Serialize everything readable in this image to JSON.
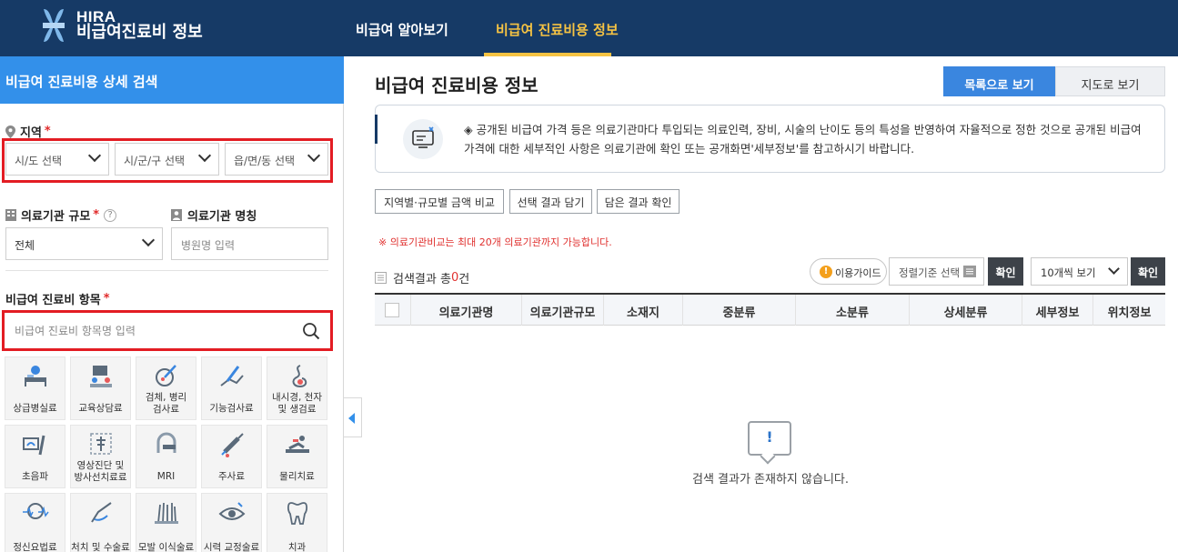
{
  "header": {
    "logo_en": "HIRA",
    "logo_ko": "비급여진료비 정보",
    "nav": [
      {
        "label": "비급여 알아보기",
        "active": false
      },
      {
        "label": "비급여 진료비용 정보",
        "active": true
      }
    ]
  },
  "sidebar": {
    "title": "비급여 진료비용 상세 검색",
    "region": {
      "label": "지역",
      "required": "*",
      "sido": "시/도 선택",
      "sigungu": "시/군/구 선택",
      "eupmyeondong": "읍/면/동 선택"
    },
    "scale": {
      "label": "의료기관 규모",
      "required": "*",
      "help": "?",
      "value": "전체"
    },
    "institution": {
      "label": "의료기관 명칭",
      "placeholder": "병원명 입력"
    },
    "items": {
      "label": "비급여 진료비 항목",
      "required": "*",
      "placeholder": "비급여 진료비 항목명 입력"
    },
    "categories": [
      {
        "label": "상급병실료",
        "icon": "hospital-bed-icon"
      },
      {
        "label": "교육상담료",
        "icon": "consultation-icon"
      },
      {
        "label": "검체, 병리\n검사료",
        "icon": "pathology-icon"
      },
      {
        "label": "기능검사료",
        "icon": "function-test-icon"
      },
      {
        "label": "내시경, 천자\n및 생검료",
        "icon": "endoscope-icon"
      },
      {
        "label": "초음파",
        "icon": "ultrasound-icon"
      },
      {
        "label": "영상진단 및\n방사선치료료",
        "icon": "radiology-icon"
      },
      {
        "label": "MRI",
        "icon": "mri-icon"
      },
      {
        "label": "주사료",
        "icon": "injection-icon"
      },
      {
        "label": "물리치료",
        "icon": "physical-therapy-icon"
      },
      {
        "label": "정신요법료",
        "icon": "psychotherapy-icon"
      },
      {
        "label": "처치 및 수술료",
        "icon": "surgery-icon"
      },
      {
        "label": "모발 이식술료",
        "icon": "hair-transplant-icon"
      },
      {
        "label": "시력 교정술료",
        "icon": "eye-icon"
      },
      {
        "label": "치과",
        "icon": "tooth-icon"
      }
    ]
  },
  "main": {
    "title": "비급여 진료비용 정보",
    "view_list": "목록으로 보기",
    "view_map": "지도로 보기",
    "notice": "◈ 공개된 비급여 가격 등은 의료기관마다 투입되는 의료인력, 장비, 시술의 난이도 등의 특성을 반영하여 자율적으로 정한 것으로 공개된 비급여 가격에 대한 세부적인 사항은 의료기관에 확인 또는 공개화면'세부정보'를 참고하시기 바랍니다.",
    "actions": [
      "지역별·규모별 금액 비교",
      "선택 결과 담기",
      "담은 결과 확인"
    ],
    "warning": "※ 의료기관비교는 최대 20개 의료기관까지 가능합니다.",
    "result_prefix": "검색결과 총",
    "result_count": "0",
    "result_suffix": "건",
    "guide": "이용가이드",
    "guide_badge": "!",
    "sort": "정렬기준 선택",
    "confirm": "확인",
    "page_size": "10개씩 보기",
    "confirm2": "확인",
    "columns": [
      "의료기관명",
      "의료기관규모",
      "소재지",
      "중분류",
      "소분류",
      "상세분류",
      "세부정보",
      "위치정보"
    ],
    "empty_mark": "!",
    "empty_text": "검색 결과가 존재하지 않습니다."
  },
  "colors": {
    "header_bg": "#163a66",
    "accent_yellow": "#f6c343",
    "sidebar_title_bg": "#3390ea",
    "highlight_red": "#e31c23",
    "primary_blue": "#3a86df"
  }
}
